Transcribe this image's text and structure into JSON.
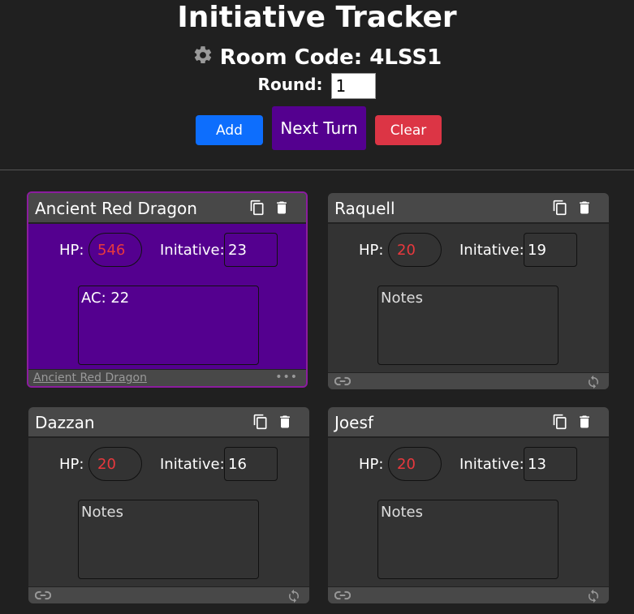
{
  "header": {
    "title": "Initiative Tracker",
    "room_code": "Room Code: 4LSS1",
    "round_label": "Round:",
    "round_value": "1",
    "add_label": "Add",
    "next_label": "Next Turn",
    "clear_label": "Clear"
  },
  "colors": {
    "background": "#202020",
    "card": "#333333",
    "card_header": "#484848",
    "active_card": "#54008f",
    "add_button": "#0d6efd",
    "next_button": "#54008f",
    "clear_button": "#dc3545",
    "hp_text": "#e8383d"
  },
  "cards": [
    {
      "name": "Ancient Red Dragon",
      "hp_label": "HP:",
      "hp": "546",
      "init_label": "Initative:",
      "initiative": "23",
      "notes": "AC: 22",
      "footer_link": "Ancient Red Dragon",
      "active": true
    },
    {
      "name": "Raquell",
      "hp_label": "HP:",
      "hp": "20",
      "init_label": "Initative:",
      "initiative": "19",
      "notes": "Notes",
      "active": false
    },
    {
      "name": "Dazzan",
      "hp_label": "HP:",
      "hp": "20",
      "init_label": "Initative:",
      "initiative": "16",
      "notes": "Notes",
      "active": false
    },
    {
      "name": "Joesf",
      "hp_label": "HP:",
      "hp": "20",
      "init_label": "Initative:",
      "initiative": "13",
      "notes": "Notes",
      "active": false
    }
  ],
  "icons": [
    "gear-icon",
    "copy-icon",
    "trash-icon",
    "link-icon",
    "sync-icon",
    "more-icon"
  ]
}
